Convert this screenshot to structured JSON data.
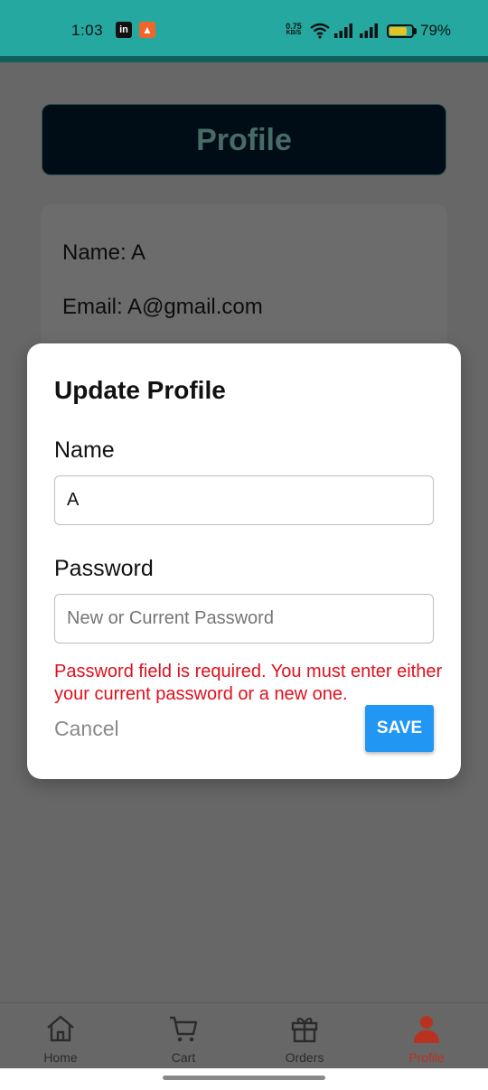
{
  "status_bar": {
    "time": "1:03",
    "app_icons": [
      "linkedin-icon",
      "tinder-icon"
    ],
    "net_speed_value": "0.75",
    "net_speed_unit": "KB/S",
    "battery_percent": "79%",
    "battery_level": 0.79
  },
  "profile_page": {
    "title": "Profile",
    "name_line": "Name: A",
    "email_line": "Email: A@gmail.com"
  },
  "dialog": {
    "title": "Update Profile",
    "name_label": "Name",
    "name_value": "A",
    "password_label": "Password",
    "password_value": "",
    "password_placeholder": "New or Current Password",
    "error_message": "Password field is required. You must enter either your current password or a new one.",
    "cancel_label": "Cancel",
    "save_label": "SAVE"
  },
  "bottom_nav": {
    "items": [
      {
        "label": "Home",
        "icon": "home-icon",
        "active": false
      },
      {
        "label": "Cart",
        "icon": "cart-icon",
        "active": false
      },
      {
        "label": "Orders",
        "icon": "gift-icon",
        "active": false
      },
      {
        "label": "Profile",
        "icon": "person-icon",
        "active": true
      }
    ]
  },
  "colors": {
    "status_bar": "#24a8a0",
    "header_bg": "#010d16",
    "header_text": "#476b66",
    "error": "#e0101d",
    "save_button": "#2196f3",
    "nav_active": "#b8331f"
  }
}
